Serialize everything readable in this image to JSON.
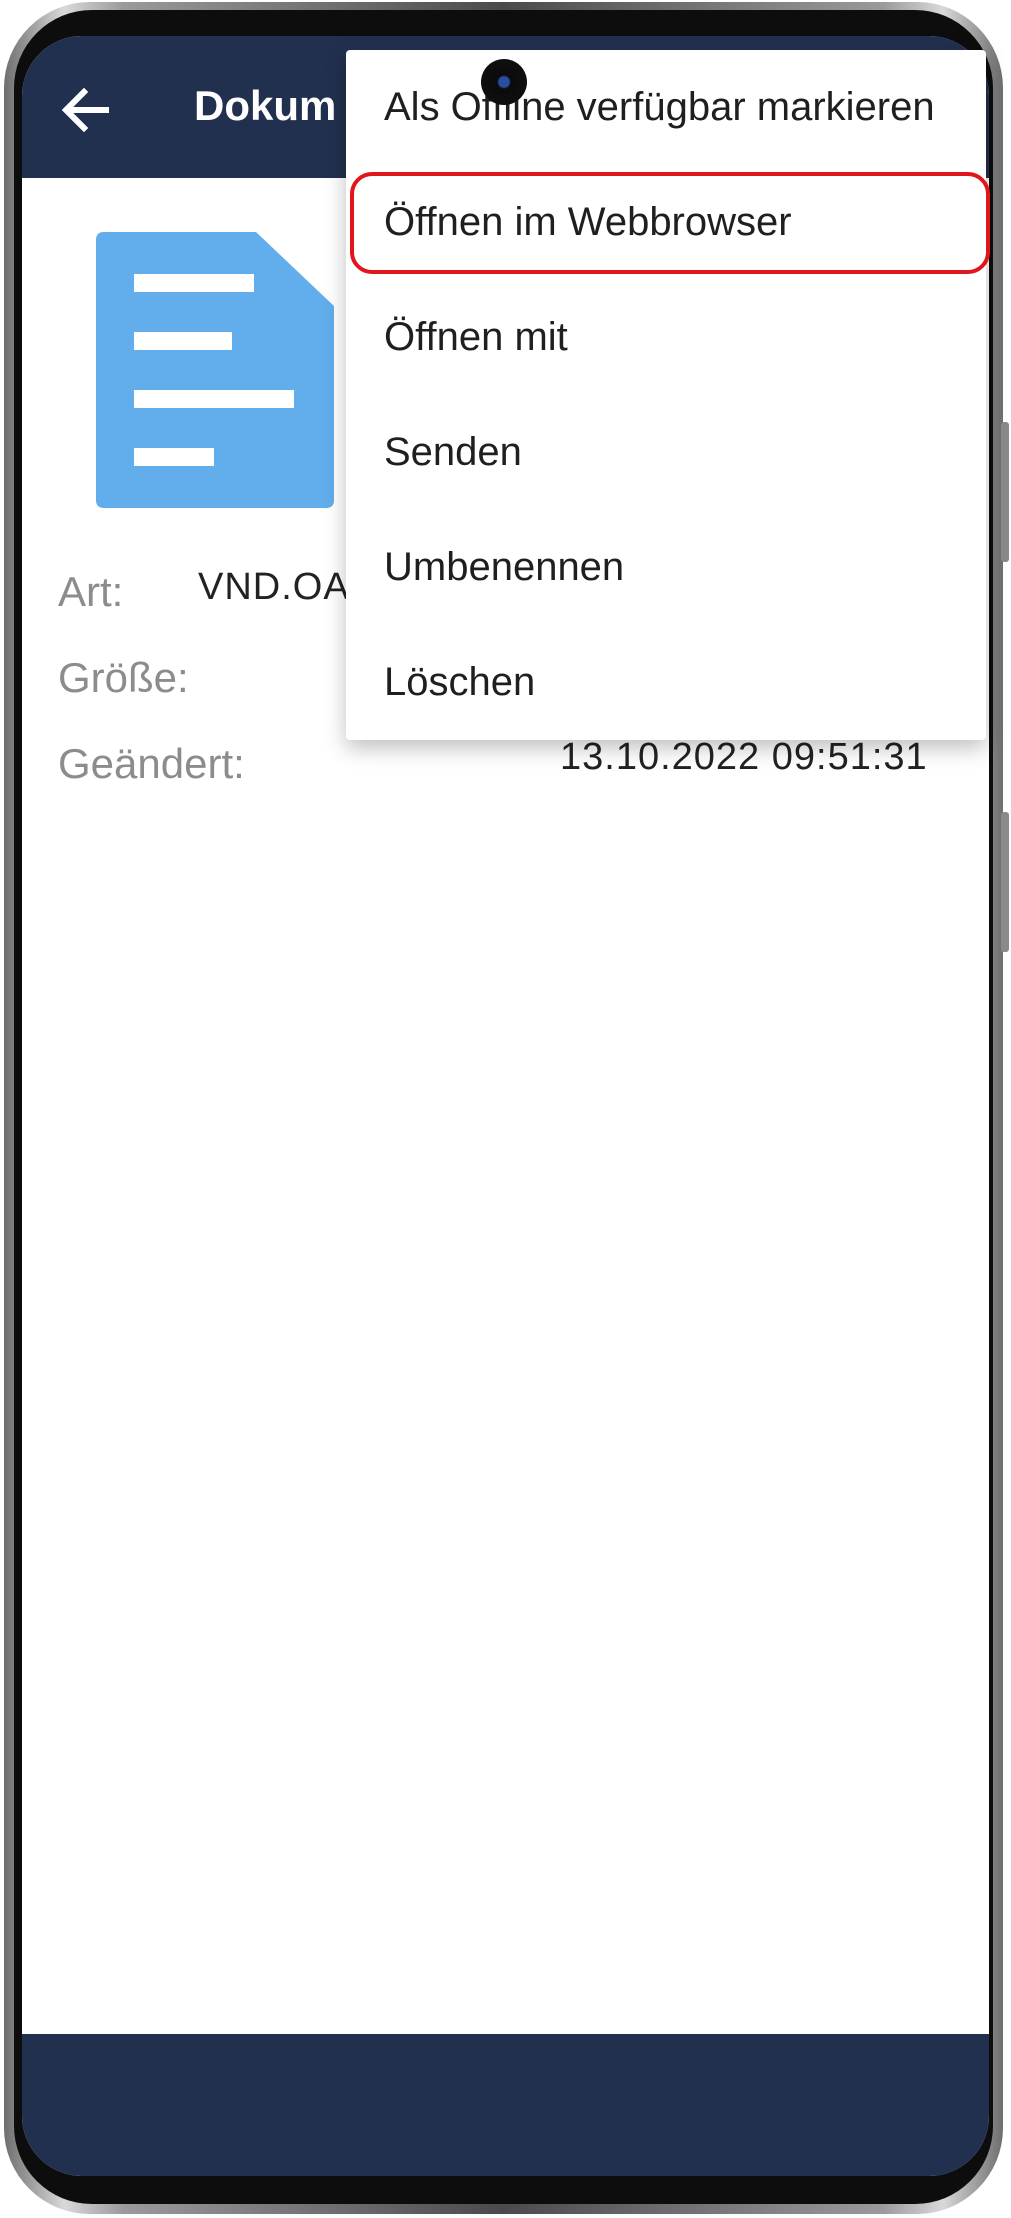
{
  "appbar": {
    "title": "Dokum"
  },
  "details": {
    "type_label": "Art:",
    "type_value": "VND.OA",
    "size_label": "Größe:",
    "modified_label": "Geändert:",
    "modified_value": "13.10.2022 09:51:31"
  },
  "menu": {
    "items": [
      {
        "label": "Als Offline verfügbar markieren"
      },
      {
        "label": "Öffnen im Webbrowser"
      },
      {
        "label": "Öffnen mit"
      },
      {
        "label": "Senden"
      },
      {
        "label": "Umbenennen"
      },
      {
        "label": "Löschen"
      }
    ]
  },
  "colors": {
    "appbar": "#22304f",
    "document_icon": "#62adec",
    "highlight": "#e0161d"
  },
  "icons": {
    "back": "arrow-left-icon",
    "document": "document-icon"
  }
}
